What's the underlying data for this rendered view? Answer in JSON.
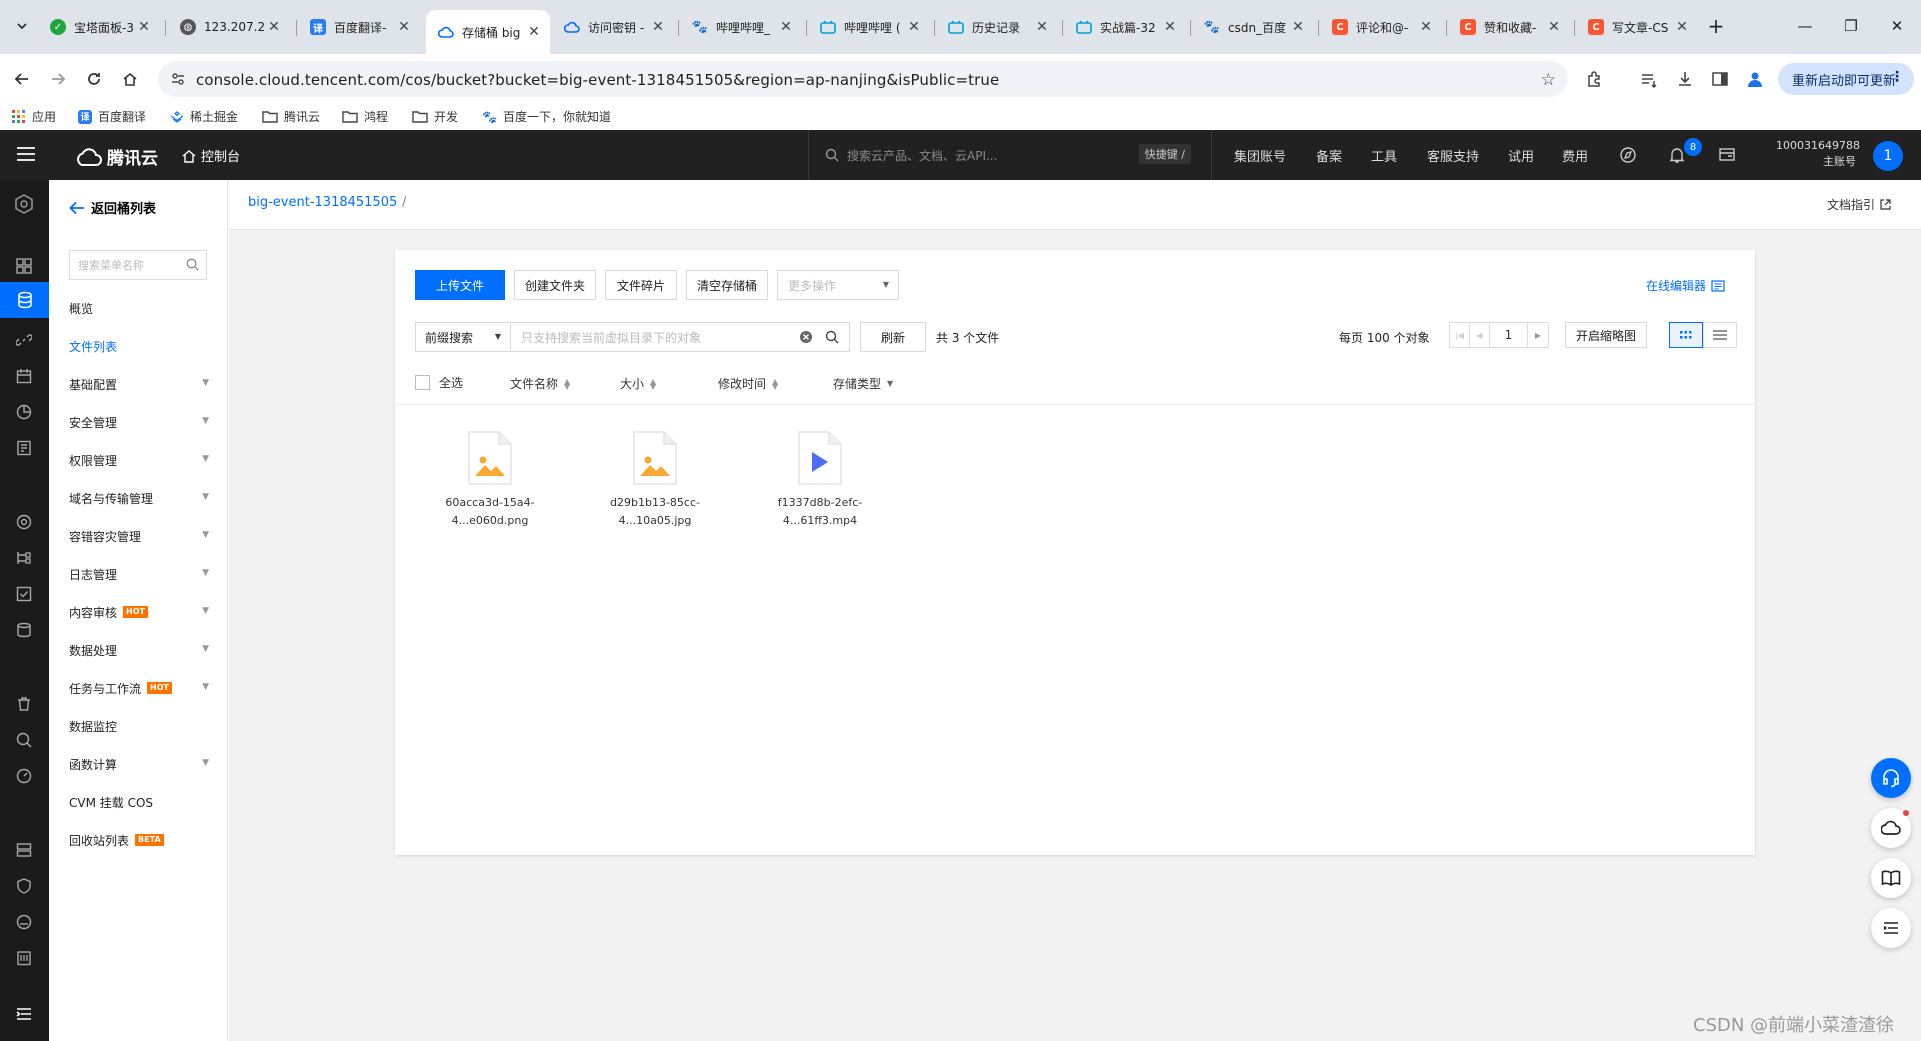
{
  "browser": {
    "tabs": [
      {
        "title": "宝塔面板-3",
        "favicon": "shield-green"
      },
      {
        "title": "123.207.2",
        "favicon": "globe"
      },
      {
        "title": "百度翻译-",
        "favicon": "baidu-translate"
      },
      {
        "title": "存储桶 big",
        "favicon": "tencent-cloud",
        "active": true
      },
      {
        "title": "访问密钥 -",
        "favicon": "tencent-cloud"
      },
      {
        "title": "哔哩哔哩_",
        "favicon": "baidu"
      },
      {
        "title": "哔哩哔哩 (",
        "favicon": "bilibili"
      },
      {
        "title": "历史记录",
        "favicon": "bilibili"
      },
      {
        "title": "实战篇-32",
        "favicon": "bilibili"
      },
      {
        "title": "csdn_百度",
        "favicon": "baidu"
      },
      {
        "title": "评论和@-",
        "favicon": "csdn"
      },
      {
        "title": "赞和收藏-",
        "favicon": "csdn"
      },
      {
        "title": "写文章-CS",
        "favicon": "csdn"
      }
    ],
    "new_tab_label": "+",
    "url": "console.cloud.tencent.com/cos/bucket?bucket=big-event-1318451505&region=ap-nanjing&isPublic=true",
    "relaunch_label": "重新启动即可更新",
    "bookmarks": [
      {
        "label": "应用",
        "icon": "apps-grid"
      },
      {
        "label": "百度翻译",
        "icon": "baidu-translate"
      },
      {
        "label": "稀土掘金",
        "icon": "juejin"
      },
      {
        "label": "腾讯云",
        "icon": "folder"
      },
      {
        "label": "鸿程",
        "icon": "folder"
      },
      {
        "label": "开发",
        "icon": "folder"
      },
      {
        "label": "百度一下，你就知道",
        "icon": "baidu"
      }
    ]
  },
  "header": {
    "logo_text": "腾讯云",
    "console_label": "控制台",
    "search_placeholder": "搜索云产品、文档、云API...",
    "hotkey_label": "快捷键 /",
    "nav": [
      "集团账号",
      "备案",
      "工具",
      "客服支持",
      "试用",
      "费用"
    ],
    "notification_count": "8",
    "account_id": "100031649788",
    "account_role": "主账号",
    "avatar_initial": "1"
  },
  "menu": {
    "back_label": "返回桶列表",
    "search_placeholder": "搜索菜单名称",
    "items": [
      {
        "label": "概览",
        "expandable": false
      },
      {
        "label": "文件列表",
        "expandable": false,
        "active": true
      },
      {
        "label": "基础配置",
        "expandable": true
      },
      {
        "label": "安全管理",
        "expandable": true
      },
      {
        "label": "权限管理",
        "expandable": true
      },
      {
        "label": "域名与传输管理",
        "expandable": true
      },
      {
        "label": "容错容灾管理",
        "expandable": true
      },
      {
        "label": "日志管理",
        "expandable": true
      },
      {
        "label": "内容审核",
        "expandable": true,
        "tag": "HOT"
      },
      {
        "label": "数据处理",
        "expandable": true
      },
      {
        "label": "任务与工作流",
        "expandable": true,
        "tag": "HOT"
      },
      {
        "label": "数据监控",
        "expandable": false
      },
      {
        "label": "函数计算",
        "expandable": true
      },
      {
        "label": "CVM 挂载 COS",
        "expandable": false
      },
      {
        "label": "回收站列表",
        "expandable": false,
        "tag": "BETA"
      }
    ]
  },
  "breadcrumb": {
    "bucket": "big-event-1318451505",
    "separator": "/",
    "doc_link": "文档指引"
  },
  "toolbar": {
    "upload": "上传文件",
    "create_folder": "创建文件夹",
    "fragments": "文件碎片",
    "clear_bucket": "清空存储桶",
    "more_actions": "更多操作",
    "online_editor": "在线编辑器"
  },
  "filter": {
    "search_mode": "前缀搜索",
    "search_placeholder": "只支持搜索当前虚拟目录下的对象",
    "refresh": "刷新",
    "total": "共 3 个文件",
    "per_page": "每页 100 个对象",
    "page": "1",
    "thumbnail_toggle": "开启缩略图"
  },
  "columns": {
    "select_all": "全选",
    "name": "文件名称",
    "size": "大小",
    "modified": "修改时间",
    "storage_class": "存储类型"
  },
  "files": [
    {
      "line1": "60acca3d-15a4-",
      "line2": "4...e060d.png",
      "type": "image"
    },
    {
      "line1": "d29b1b13-85cc-",
      "line2": "4...10a05.jpg",
      "type": "image"
    },
    {
      "line1": "f1337d8b-2efc-",
      "line2": "4...61ff3.mp4",
      "type": "video"
    }
  ],
  "watermark": "CSDN @前端小菜渣渣徐",
  "colors": {
    "accent": "#006eff",
    "hot_tag": "#ff7200",
    "header_bg": "#212121",
    "image_icon": "#f7a933",
    "video_icon": "#4b6cf7"
  }
}
